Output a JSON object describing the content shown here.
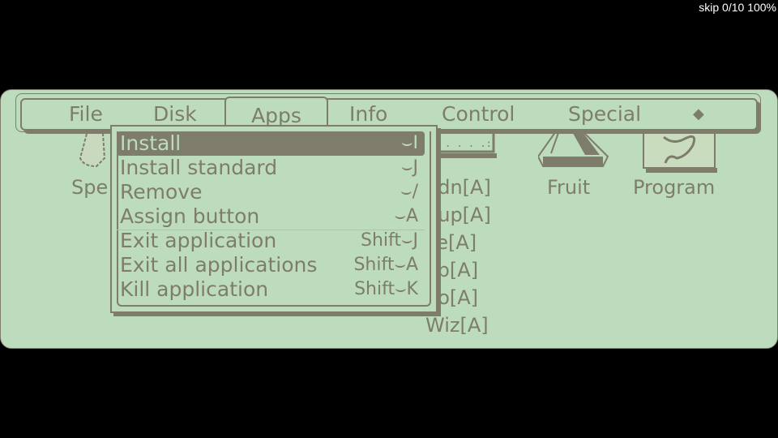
{
  "status": {
    "text": "skip 0/10 100%"
  },
  "menubar": {
    "items": [
      {
        "label": "File"
      },
      {
        "label": "Disk"
      },
      {
        "label": "Apps",
        "active": true
      },
      {
        "label": "Info"
      },
      {
        "label": "Control"
      },
      {
        "label": "Special"
      },
      {
        "label": "◆"
      }
    ]
  },
  "apps_menu": {
    "items": [
      {
        "label": "Install",
        "shortcut": "⌣I",
        "selected": true
      },
      {
        "label": "Install standard",
        "shortcut": "⌣J"
      },
      {
        "label": "Remove",
        "shortcut": "⌣/"
      },
      {
        "label": "Assign button",
        "shortcut": "⌣A"
      },
      {
        "label": "Exit application",
        "shortcut": "Shift⌣J"
      },
      {
        "label": "Exit all applications",
        "shortcut": "Shift⌣A"
      },
      {
        "label": "Kill application",
        "shortcut": "Shift⌣K"
      }
    ]
  },
  "desktop": {
    "icons": [
      {
        "label": "Spe"
      },
      {
        "label": "Fruit"
      },
      {
        "label": "Program"
      }
    ],
    "list": [
      "ddn[A]",
      "dup[A]",
      "ce[A]",
      "op[A]",
      "no[A]",
      "Wiz[A]"
    ]
  }
}
